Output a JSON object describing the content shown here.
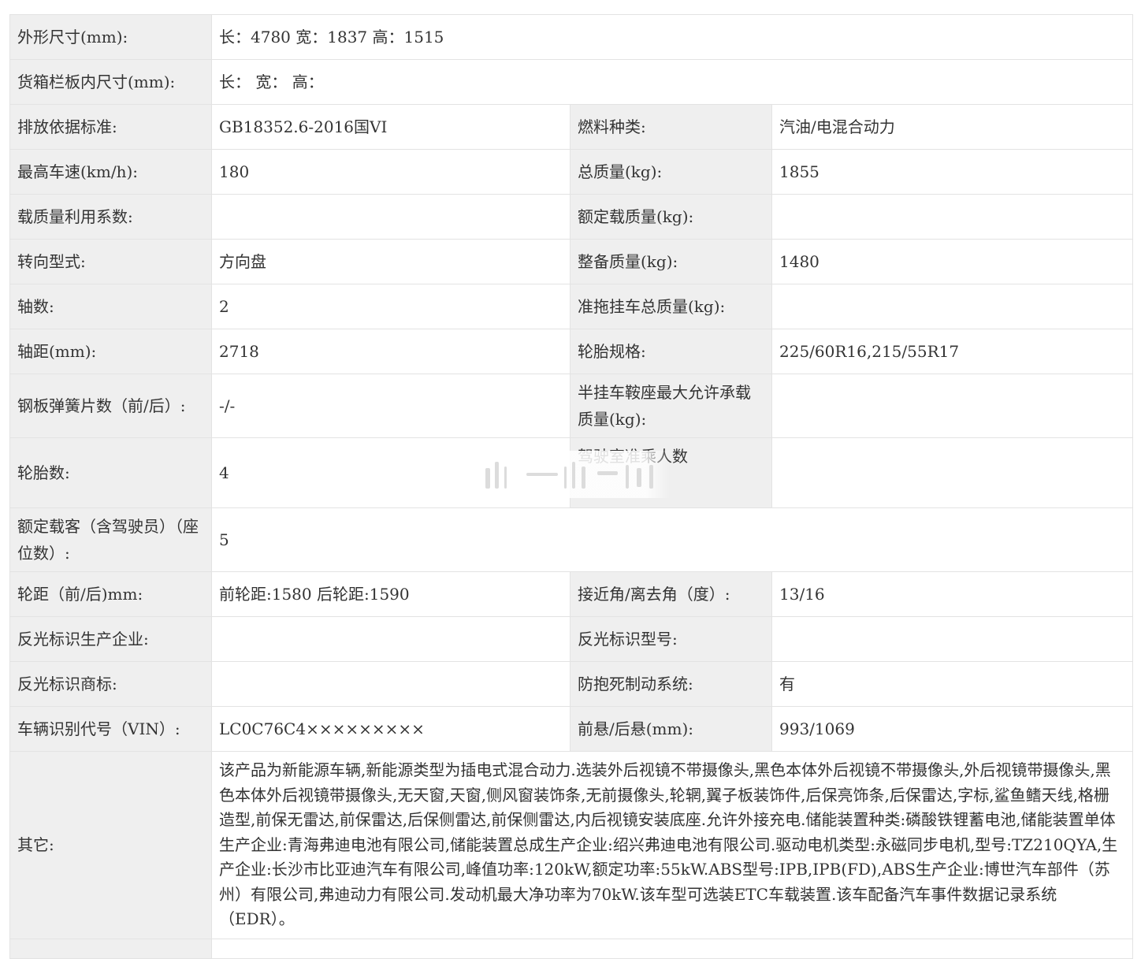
{
  "rows": {
    "r0": {
      "l1": "外形尺寸(mm):",
      "v1": "长：4780 宽：1837 高：1515"
    },
    "r1": {
      "l1": "货箱栏板内尺寸(mm):",
      "v1": "长：  宽：  高："
    },
    "r2": {
      "l1": "排放依据标准:",
      "v1": "GB18352.6-2016国VI",
      "l2": "燃料种类:",
      "v2": "汽油/电混合动力"
    },
    "r3": {
      "l1": "最高车速(km/h):",
      "v1": "180",
      "l2": "总质量(kg):",
      "v2": "1855"
    },
    "r4": {
      "l1": "载质量利用系数:",
      "v1": "",
      "l2": "额定载质量(kg):",
      "v2": ""
    },
    "r5": {
      "l1": "转向型式:",
      "v1": "方向盘",
      "l2": "整备质量(kg):",
      "v2": "1480"
    },
    "r6": {
      "l1": "轴数:",
      "v1": "2",
      "l2": "准拖挂车总质量(kg):",
      "v2": ""
    },
    "r7": {
      "l1": "轴距(mm):",
      "v1": "2718",
      "l2": "轮胎规格:",
      "v2": "225/60R16,215/55R17"
    },
    "r8": {
      "l1": "钢板弹簧片数（前/后）:",
      "v1": "-/-",
      "l2": "半挂车鞍座最大允许承载质量(kg):",
      "v2": ""
    },
    "r9": {
      "l1": "轮胎数:",
      "v1": "4",
      "l2": "驾驶室准乘人数",
      "v2": ""
    },
    "r10": {
      "l1": "额定载客（含驾驶员）（座位数）:",
      "v1": "5"
    },
    "r11": {
      "l1": "轮距（前/后)mm:",
      "v1": "前轮距:1580 后轮距:1590",
      "l2": "接近角/离去角（度）:",
      "v2": "13/16"
    },
    "r12": {
      "l1": "反光标识生产企业:",
      "v1": "",
      "l2": "反光标识型号:",
      "v2": ""
    },
    "r13": {
      "l1": "反光标识商标:",
      "v1": "",
      "l2": "防抱死制动系统:",
      "v2": "有"
    },
    "r14": {
      "l1": "车辆识别代号（VIN）:",
      "v1": "LC0C76C4×××××××××",
      "l2": "前悬/后悬(mm):",
      "v2": "993/1069"
    },
    "r15": {
      "l1": "其它:",
      "v1": "该产品为新能源车辆,新能源类型为插电式混合动力.选装外后视镜不带摄像头,黑色本体外后视镜不带摄像头,外后视镜带摄像头,黑色本体外后视镜带摄像头,无天窗,天窗,侧风窗装饰条,无前摄像头,轮辋,翼子板装饰件,后保亮饰条,后保雷达,字标,鲨鱼鳍天线,格栅造型,前保无雷达,前保雷达,后保侧雷达,前保侧雷达,内后视镜安装底座.允许外接充电.储能装置种类:磷酸铁锂蓄电池,储能装置单体生产企业:青海弗迪电池有限公司,储能装置总成生产企业:绍兴弗迪电池有限公司.驱动电机类型:永磁同步电机,型号:TZ210QYA,生产企业:长沙市比亚迪汽车有限公司,峰值功率:120kW,额定功率:55kW.ABS型号:IPB,IPB(FD),ABS生产企业:博世汽车部件（苏州）有限公司,弗迪动力有限公司.发动机最大净功率为70kW.该车型可选装ETC车载装置.该车配备汽车事件数据记录系统（EDR）。"
    }
  }
}
